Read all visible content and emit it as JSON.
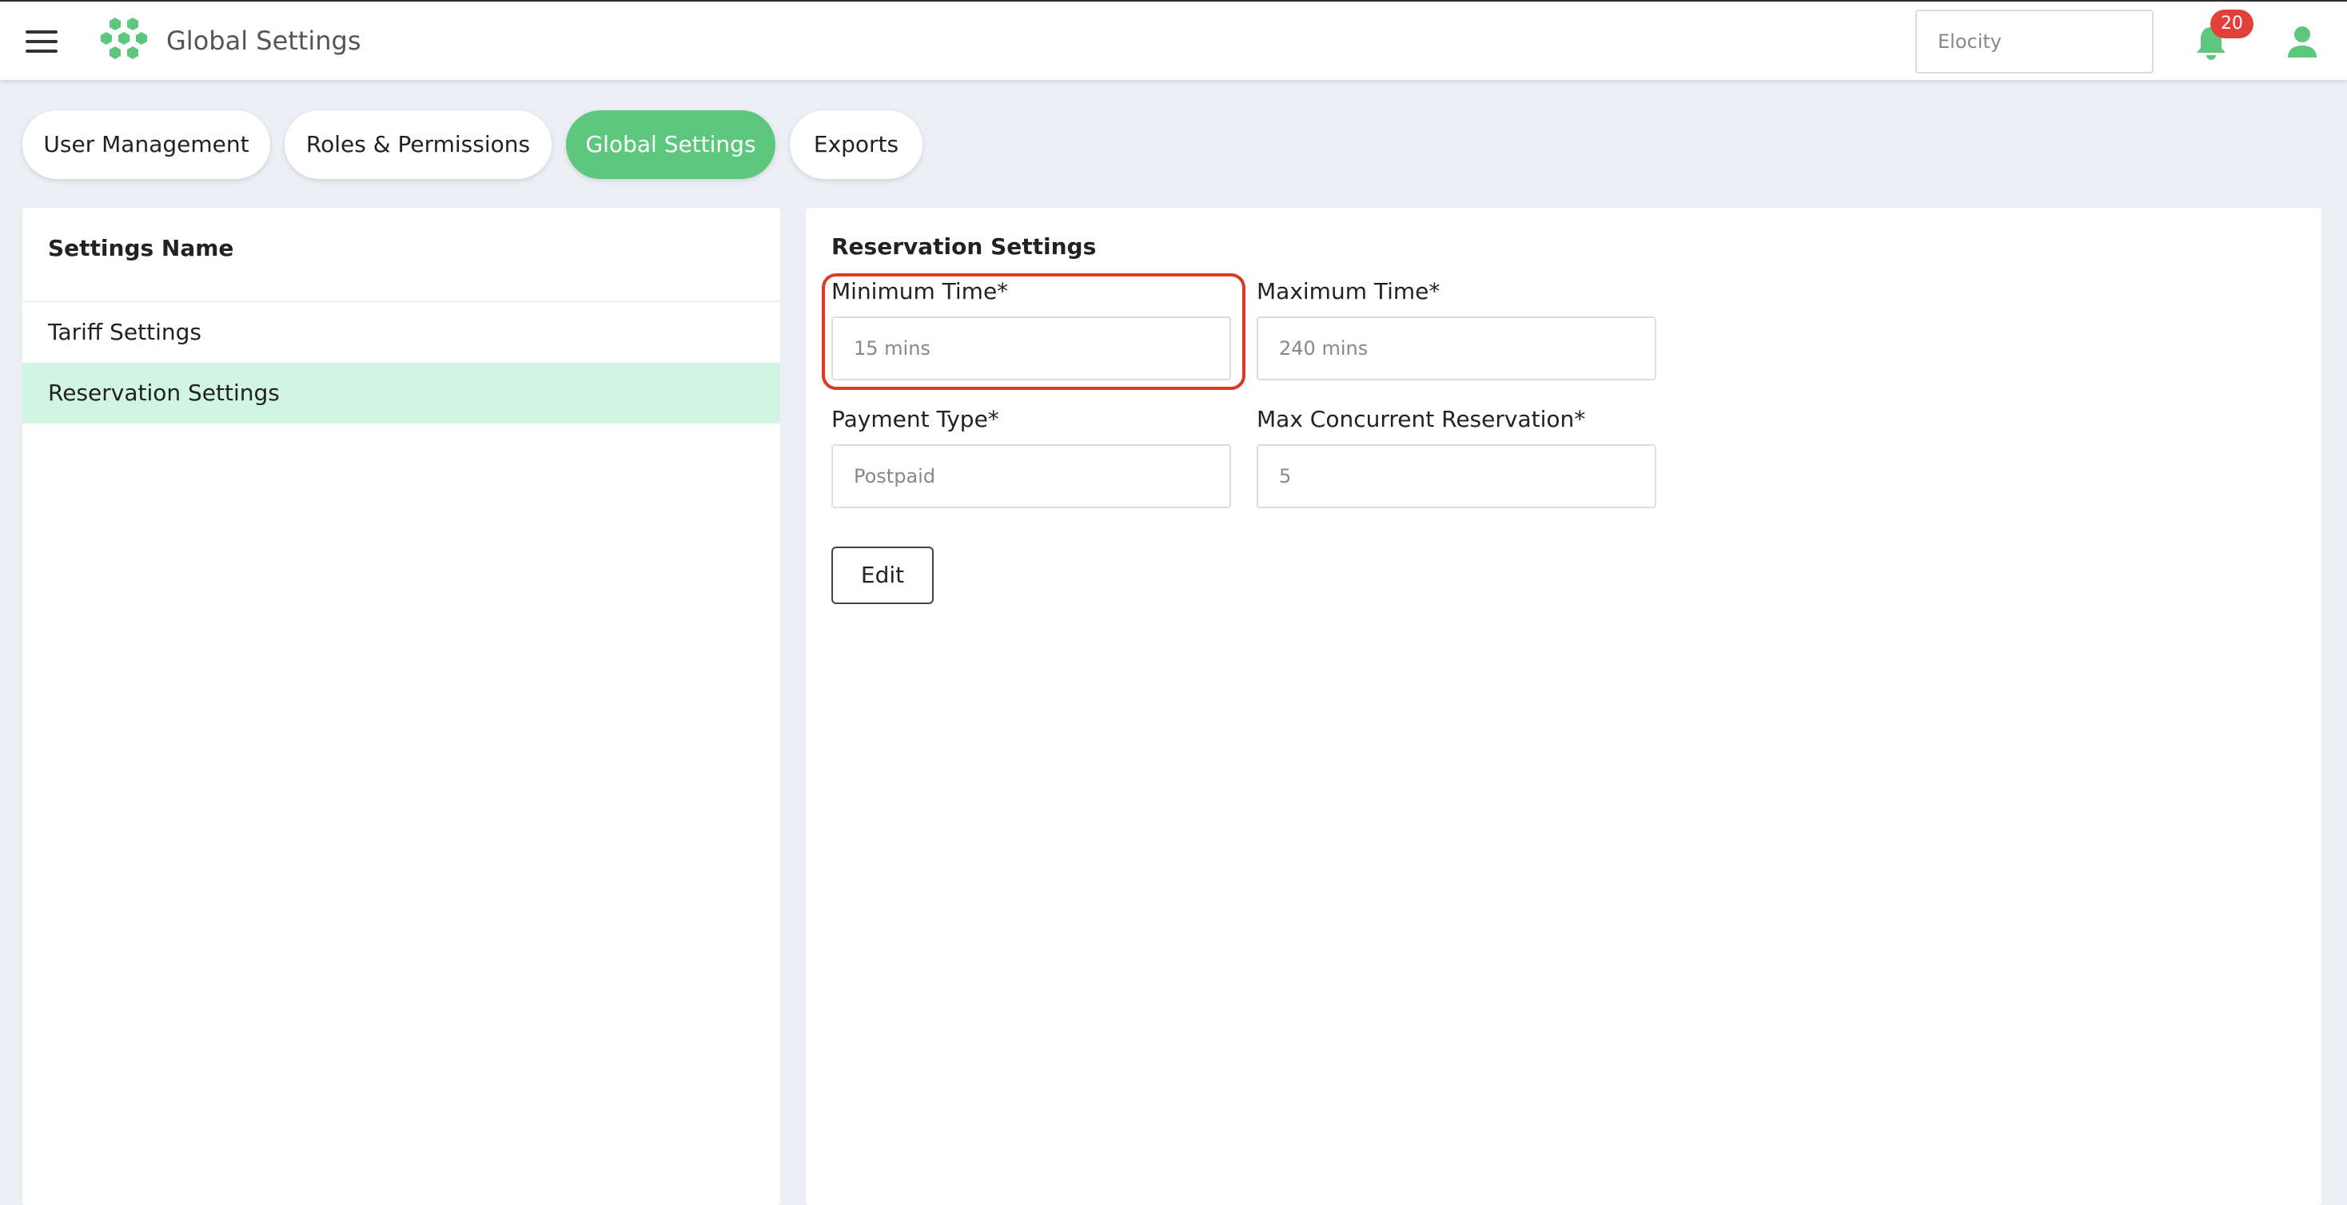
{
  "header": {
    "title": "Global Settings",
    "org_value": "Elocity",
    "notification_count": "20",
    "icons": {
      "menu": "hamburger-icon",
      "logo": "hexagon-cluster-logo",
      "bell": "bell-icon",
      "user": "person-icon"
    },
    "colors": {
      "brand_green": "#5cc77d",
      "badge_red": "#e3403a"
    }
  },
  "tabs": [
    {
      "label": "User Management"
    },
    {
      "label": "Roles & Permissions"
    },
    {
      "label": "Global Settings",
      "active": true
    },
    {
      "label": "Exports"
    }
  ],
  "left_panel": {
    "header": "Settings Name",
    "items": [
      {
        "label": "Tariff Settings"
      },
      {
        "label": "Reservation Settings",
        "selected": true
      }
    ]
  },
  "reservation": {
    "title": "Reservation Settings",
    "min_time_label": "Minimum Time*",
    "min_time_value": "15 mins",
    "max_time_label": "Maximum Time*",
    "max_time_value": "240 mins",
    "payment_type_label": "Payment Type*",
    "payment_type_value": "Postpaid",
    "max_concurrent_label": "Max Concurrent Reservation*",
    "max_concurrent_value": "5",
    "edit_label": "Edit",
    "highlight_color": "#dd3a26"
  }
}
